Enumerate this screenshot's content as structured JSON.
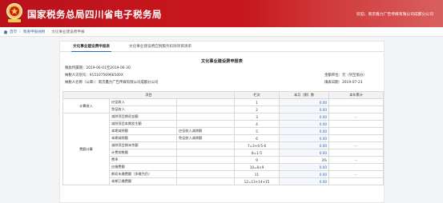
{
  "header": {
    "title": "国家税务总局四川省电子税务局",
    "welcome": "欢迎，南京鑫力广告传媒有限公司成都分公司"
  },
  "breadcrumb": {
    "home": "首页",
    "level1": "我要申报纳税",
    "level2": "文化事业建设费申报"
  },
  "tabs": [
    {
      "label": "文化事业建设费申报表"
    },
    {
      "label": "文化事业建设费应税服务扣除项目清单"
    }
  ],
  "form": {
    "title": "文化事业建设费申报表",
    "period": "税款所属期：2019-06-01至2019-06-30",
    "taxpayer_id": "纳税人识别号：91510756966540X",
    "unit": "金额单位：元（列至角分）",
    "taxpayer_name": "纳税人名称（公章）：南京鑫力广告传媒有限公司成都分公司",
    "fill_date": "填表日期：2019-07-23"
  },
  "table": {
    "headers": [
      "项目",
      "",
      "栏次",
      "本月（期）数",
      "本年累计"
    ],
    "rows": [
      {
        "group": "计費收入",
        "item": "应征收入",
        "sub": "",
        "col": "1",
        "month": "0.00",
        "year": ""
      },
      {
        "group": "",
        "item": "免征收入",
        "sub": "",
        "col": "2",
        "month": "0.00",
        "year": ""
      },
      {
        "group": "",
        "item": "减除项目期初金额",
        "sub": "",
        "col": "3",
        "month": "0.00",
        "year": "--"
      },
      {
        "group": "费额计算",
        "item": "减除项目本期发生额",
        "sub": "",
        "col": "4",
        "month": "0.00",
        "year": ""
      },
      {
        "group": "",
        "item": "本期减除额",
        "sub": "应征收入减除额",
        "col": "5",
        "month": "0.00",
        "year": ""
      },
      {
        "group": "",
        "item": "本期减除额",
        "sub": "免征收入减除额",
        "col": "6",
        "month": "0.00",
        "year": ""
      },
      {
        "group": "",
        "item": "减除项目期末余额",
        "sub": "",
        "col": "7=3+4-5-6",
        "month": "0.00",
        "year": "--"
      },
      {
        "group": "",
        "item": "计费销售额",
        "sub": "",
        "col": "8=1-5",
        "month": "0.00",
        "year": ""
      },
      {
        "group": "",
        "item": "费率",
        "sub": "",
        "col": "9",
        "month": "3%",
        "year": "--"
      },
      {
        "group": "",
        "item": "应缴费额",
        "sub": "",
        "col": "10=8×9",
        "month": "0.00",
        "year": ""
      },
      {
        "group": "",
        "item": "期初未缴费额（多缴为负）",
        "sub": "",
        "col": "11",
        "month": "0.00",
        "year": "--"
      },
      {
        "group": "",
        "item": "本期已缴费额",
        "sub": "",
        "col": "12=13+14+15",
        "month": "0.00",
        "year": ""
      }
    ]
  },
  "colors": {
    "header_red": "#c8161d",
    "link_blue": "#2a6ab8"
  },
  "icons": [
    "emblem-icon",
    "home-icon"
  ]
}
